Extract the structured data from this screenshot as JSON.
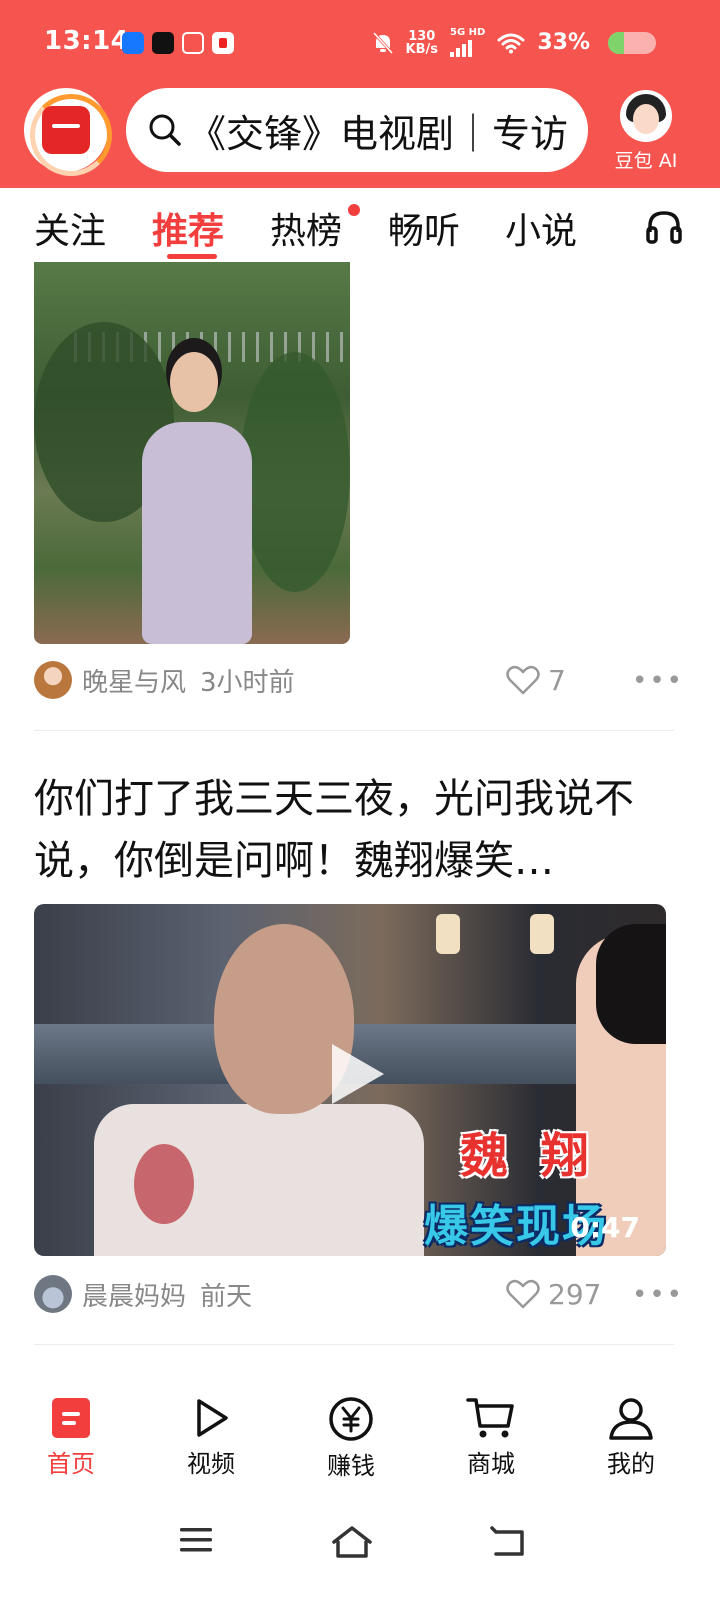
{
  "status_bar": {
    "time": "13:14",
    "net_speed_value": "130",
    "net_speed_unit": "KB/s",
    "network": "5G HD",
    "battery": "33%",
    "battery_level": 0.33
  },
  "header": {
    "search_text": "《交锋》电视剧｜专访",
    "ai_label": "豆包 AI"
  },
  "tabs": [
    {
      "label": "关注"
    },
    {
      "label": "推荐",
      "active": true
    },
    {
      "label": "热榜",
      "badge_dot": true
    },
    {
      "label": "畅听"
    },
    {
      "label": "小说"
    }
  ],
  "feed": [
    {
      "author": "晚星与风",
      "time": "3小时前",
      "likes": "7"
    },
    {
      "title": "你们打了我三天三夜，光问我说不说，你倒是问啊！魏翔爆笑…",
      "caption_top": "魏 翔",
      "caption_bottom": "爆笑现场",
      "duration": "0:47",
      "author": "晨晨妈妈",
      "time": "前天",
      "likes": "297"
    }
  ],
  "bottom_nav": [
    {
      "label": "首页",
      "active": true
    },
    {
      "label": "视频"
    },
    {
      "label": "赚钱"
    },
    {
      "label": "商城"
    },
    {
      "label": "我的"
    }
  ],
  "colors": {
    "brand_red": "#f6554f",
    "accent_red": "#f33e3e"
  }
}
